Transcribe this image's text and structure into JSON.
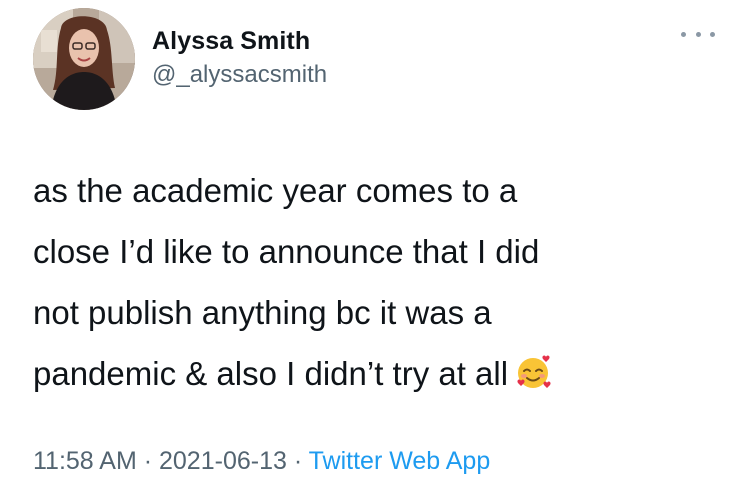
{
  "author": {
    "name": "Alyssa Smith",
    "handle": "@_alyssacsmith"
  },
  "tweet": {
    "lines": [
      "as the academic year comes to a",
      "close I’d like to announce that I did",
      "not publish anything bc it was a",
      "pandemic & also I didn’t try at all"
    ],
    "emoji": "smiling-face-with-hearts"
  },
  "meta": {
    "time": "11:58 AM",
    "separator": " · ",
    "date": "2021-06-13",
    "app": "Twitter Web App"
  },
  "colors": {
    "text": "#0f1419",
    "secondary": "#536471",
    "link": "#1d9bf0"
  }
}
